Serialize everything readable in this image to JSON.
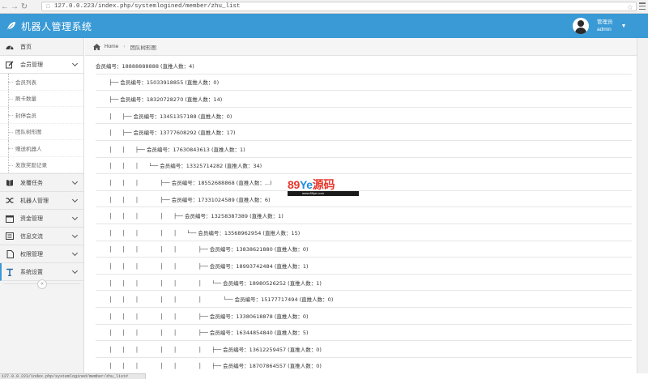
{
  "browser": {
    "url": "127.0.0.223/index.php/systemlogined/member/zhu_list",
    "back_icon": "arrow-left-icon",
    "forward_icon": "arrow-right-icon",
    "reload_icon": "reload-icon"
  },
  "header": {
    "title": "机器人管理系统",
    "user_role": "管理员",
    "user_name": "admin",
    "accent_color": "#3a9ad6"
  },
  "sidebar": {
    "items": [
      {
        "label": "首页",
        "icon": "dashboard-icon"
      },
      {
        "label": "会员管理",
        "icon": "edit-icon"
      },
      {
        "label": "发覆任务",
        "icon": "book-icon"
      },
      {
        "label": "机器人管理",
        "icon": "shuffle-icon"
      },
      {
        "label": "资金管理",
        "icon": "calendar-icon"
      },
      {
        "label": "信息交流",
        "icon": "list-icon"
      },
      {
        "label": "权限管理",
        "icon": "file-icon"
      },
      {
        "label": "系统设置",
        "icon": "tools-icon"
      }
    ],
    "submenu": [
      "会员列表",
      "刷卡数量",
      "封停会员",
      "团队树形图",
      "赠送机器人",
      "发放奖励记录"
    ]
  },
  "breadcrumb": {
    "home": "Home",
    "current": "团队树形图"
  },
  "tree": [
    "会员编号：18888888888 (直推人数：4)",
    "        ├── 会员编号：15033918855 (直推人数：0)",
    "        ├── 会员编号：18320728270 (直推人数：14)",
    "        │      ├── 会员编号：13451357188 (直推人数：0)",
    "        │      ├── 会员编号：13777608292 (直推人数：17)",
    "        │      │      ├── 会员编号：17630843613 (直推人数：1)",
    "        │      │      │      └── 会员编号：13325714282 (直推人数：34)",
    "        │      │      │             ├── 会员编号：18552688868 (直推人数：...)",
    "        │      │      │             ├── 会员编号：17331024589 (直推人数：6)",
    "        │      │      │             │      ├── 会员编号：13258387389 (直推人数：1)",
    "        │      │      │             │      │      └── 会员编号：13568962954 (直推人数：15)",
    "        │      │      │             │      │             ├── 会员编号：13838621880 (直推人数：0)",
    "        │      │      │             │      │             ├── 会员编号：18993742484 (直推人数：1)",
    "        │      │      │             │      │             │      └── 会员编号：18980526252 (直推人数：1)",
    "        │      │      │             │      │             │             └── 会员编号：15177717494 (直推人数：0)",
    "        │      │      │             │      │             ├── 会员编号：13380618878 (直推人数：0)",
    "        │      │      │             │      │             ├── 会员编号：16344854840 (直推人数：5)",
    "        │      │      │             │      │             │      ├── 会员编号：13612259457 (直推人数：0)",
    "        │      │      │             │      │             │      ├── 会员编号：18707864557 (直推人数：0)"
  ],
  "status_bar": "127.0.0.223/index.php/systemlogined/member/zhu_list#",
  "watermark": {
    "part1": "89",
    "part2": "Ye",
    "part3": "源码",
    "sub": "www.89ye.com"
  }
}
